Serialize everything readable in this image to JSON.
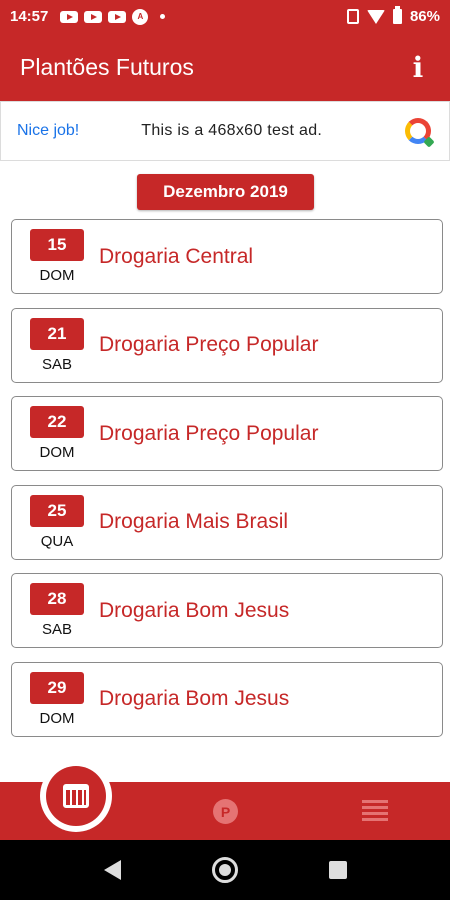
{
  "status_bar": {
    "time": "14:57",
    "battery": "86%",
    "notification_icons": [
      "youtube-icon",
      "youtube-icon",
      "youtube-icon",
      "accessibility-icon"
    ]
  },
  "app_bar": {
    "title": "Plantões Futuros",
    "info_icon": "i"
  },
  "ad": {
    "nice_job": "Nice job!",
    "text": "This is a 468x60 test ad."
  },
  "month": "Dezembro 2019",
  "shifts": [
    {
      "day": "15",
      "weekday": "DOM",
      "pharmacy": "Drogaria Central"
    },
    {
      "day": "21",
      "weekday": "SAB",
      "pharmacy": "Drogaria Preço Popular"
    },
    {
      "day": "22",
      "weekday": "DOM",
      "pharmacy": "Drogaria Preço Popular"
    },
    {
      "day": "25",
      "weekday": "QUA",
      "pharmacy": "Drogaria Mais Brasil"
    },
    {
      "day": "28",
      "weekday": "SAB",
      "pharmacy": "Drogaria Bom Jesus"
    },
    {
      "day": "29",
      "weekday": "DOM",
      "pharmacy": "Drogaria Bom Jesus"
    }
  ],
  "bottom_nav": {
    "p_label": "P"
  },
  "colors": {
    "primary": "#c62828",
    "ad_link": "#1a73e8"
  }
}
